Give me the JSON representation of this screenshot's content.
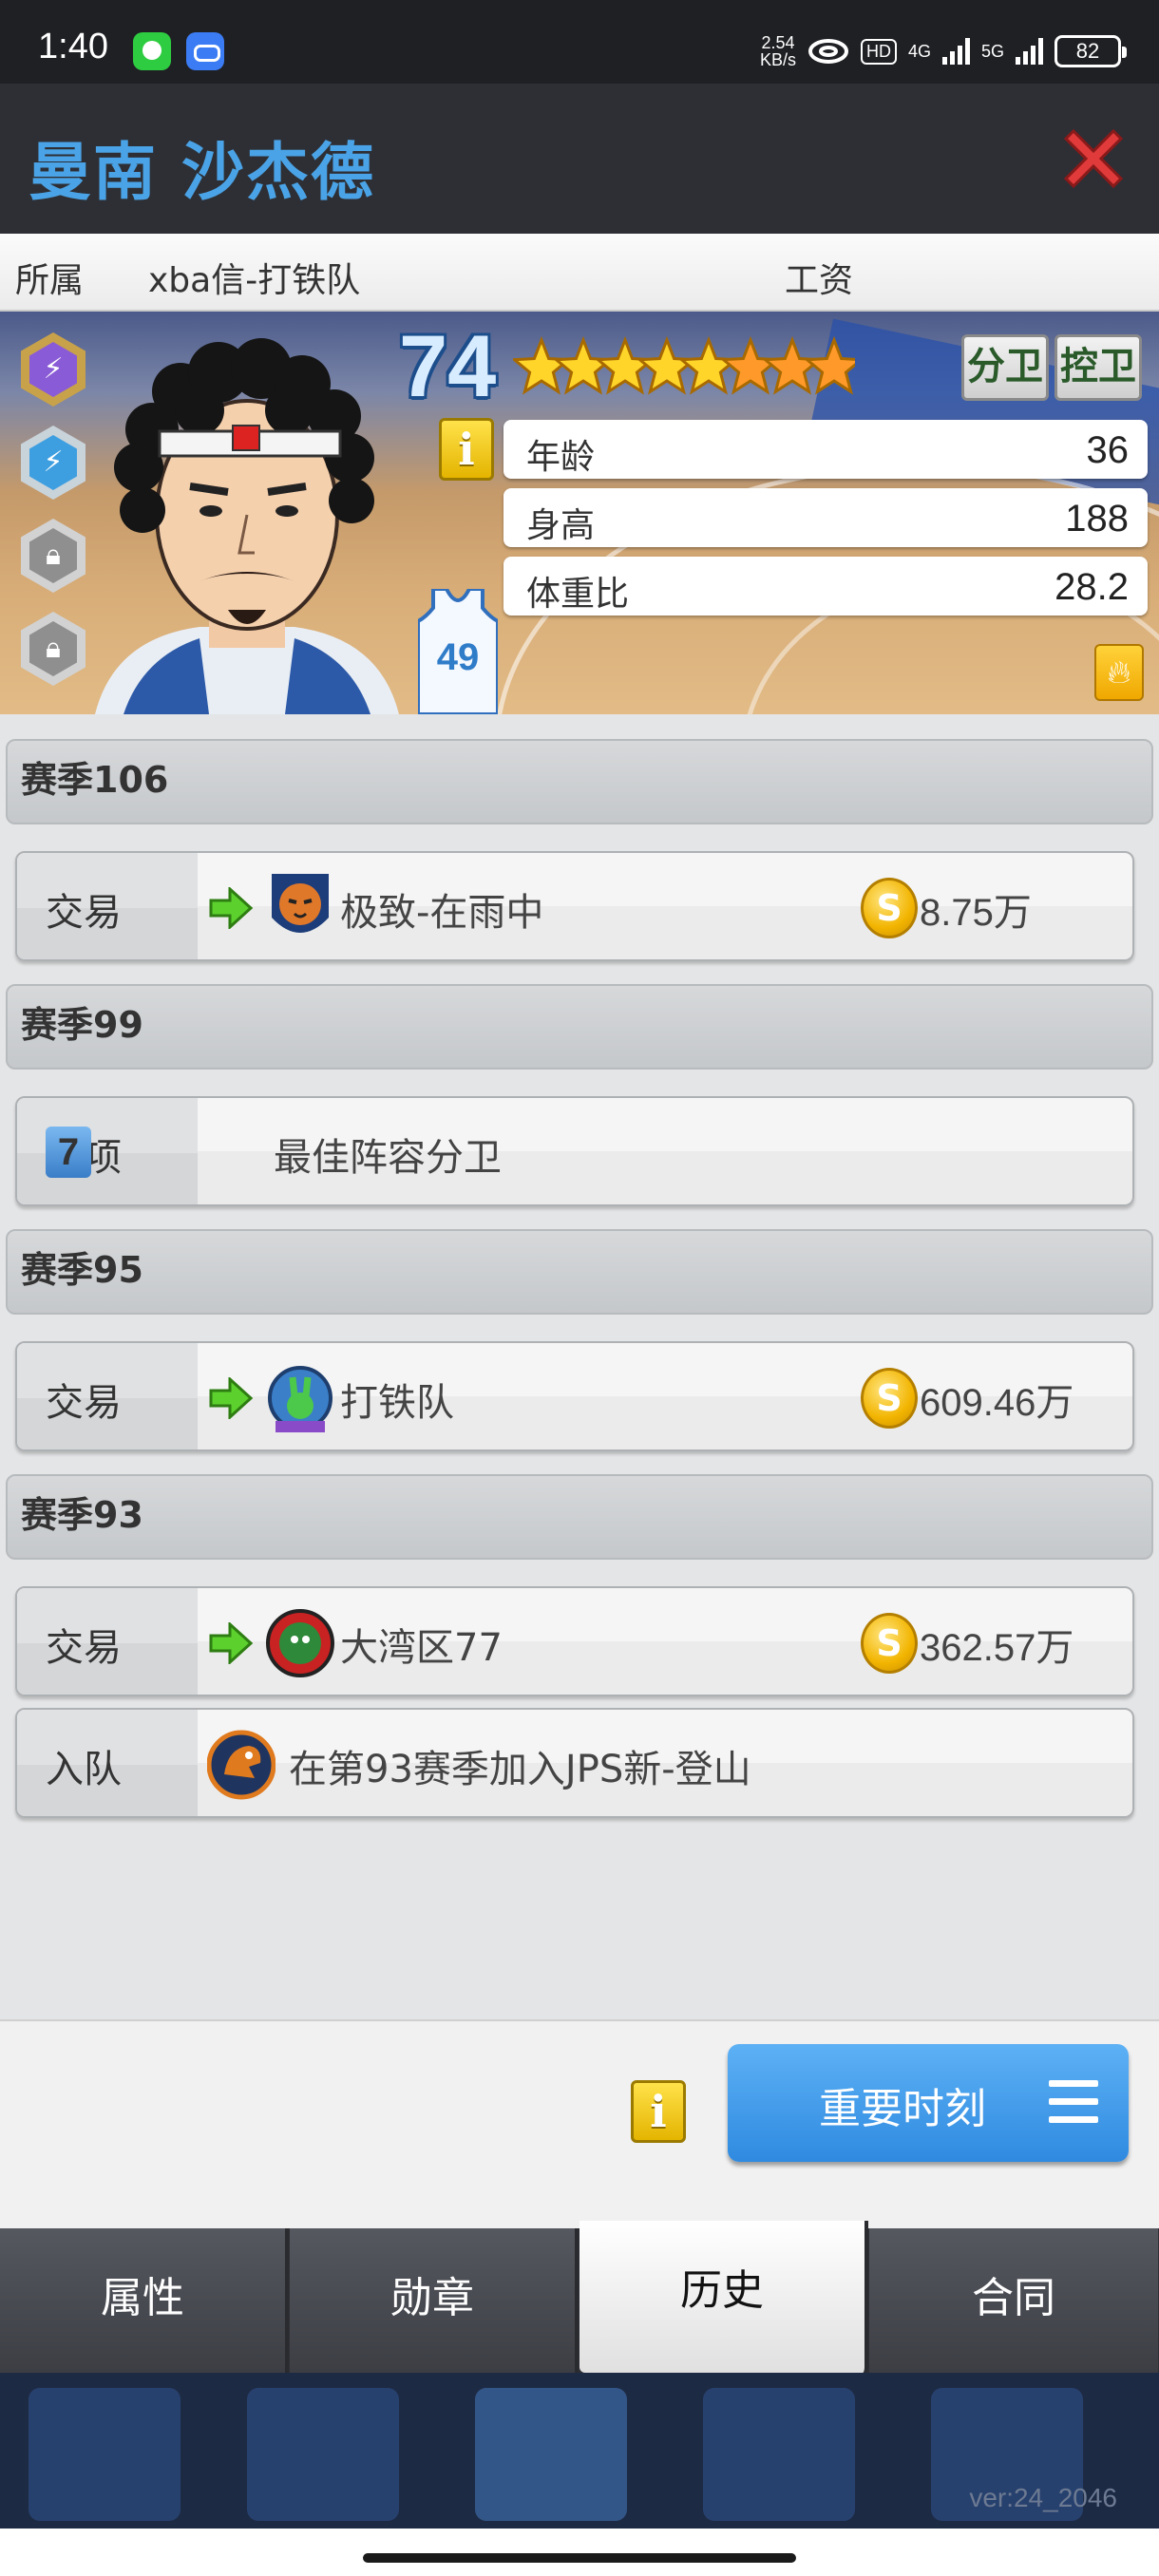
{
  "status_bar": {
    "time": "1:40",
    "net_speed_value": "2.54",
    "net_speed_unit": "KB/s",
    "hd": "HD",
    "sig1": "4G",
    "sig2": "5G",
    "battery": "82"
  },
  "header": {
    "player_name": "曼南 沙杰德"
  },
  "team_row": {
    "affiliation_label": "所属",
    "team": "xba信-打铁队",
    "salary_label": "工资"
  },
  "card": {
    "rating": "74",
    "stars_total": 8,
    "stars_gold": 5,
    "stars_orange": 3,
    "jersey_number": "49",
    "positions": [
      "分卫",
      "控卫"
    ],
    "stats": [
      {
        "label": "年龄",
        "value": "36"
      },
      {
        "label": "身高",
        "value": "188"
      },
      {
        "label": "体重比",
        "value": "28.2"
      }
    ],
    "info_glyph": "i"
  },
  "history": [
    {
      "season": "赛季106",
      "rows": [
        {
          "kind": "交易",
          "team": "极致-在雨中",
          "amount": "8.75万"
        }
      ]
    },
    {
      "season": "赛季99",
      "rows": [
        {
          "kind": "奖项",
          "award_count": "7",
          "text": "最佳阵容分卫"
        }
      ]
    },
    {
      "season": "赛季95",
      "rows": [
        {
          "kind": "交易",
          "team": "打铁队",
          "amount": "609.46万"
        }
      ]
    },
    {
      "season": "赛季93",
      "rows": [
        {
          "kind": "交易",
          "team": "大湾区77",
          "amount": "362.57万"
        },
        {
          "kind": "入队",
          "text": "在第93赛季加入JPS新-登山"
        }
      ]
    }
  ],
  "coin_glyph": "S",
  "moments_button": {
    "label": "重要时刻"
  },
  "tabs": [
    {
      "label": "属性",
      "active": false
    },
    {
      "label": "勋章",
      "active": false
    },
    {
      "label": "历史",
      "active": true
    },
    {
      "label": "合同",
      "active": false
    }
  ],
  "version": "ver:24_2046",
  "colors": {
    "name_blue": "#4aa3e6",
    "close_red": "#e03a3a",
    "button_blue": "#3a94e6",
    "tab_bg": "#4a4c52"
  }
}
